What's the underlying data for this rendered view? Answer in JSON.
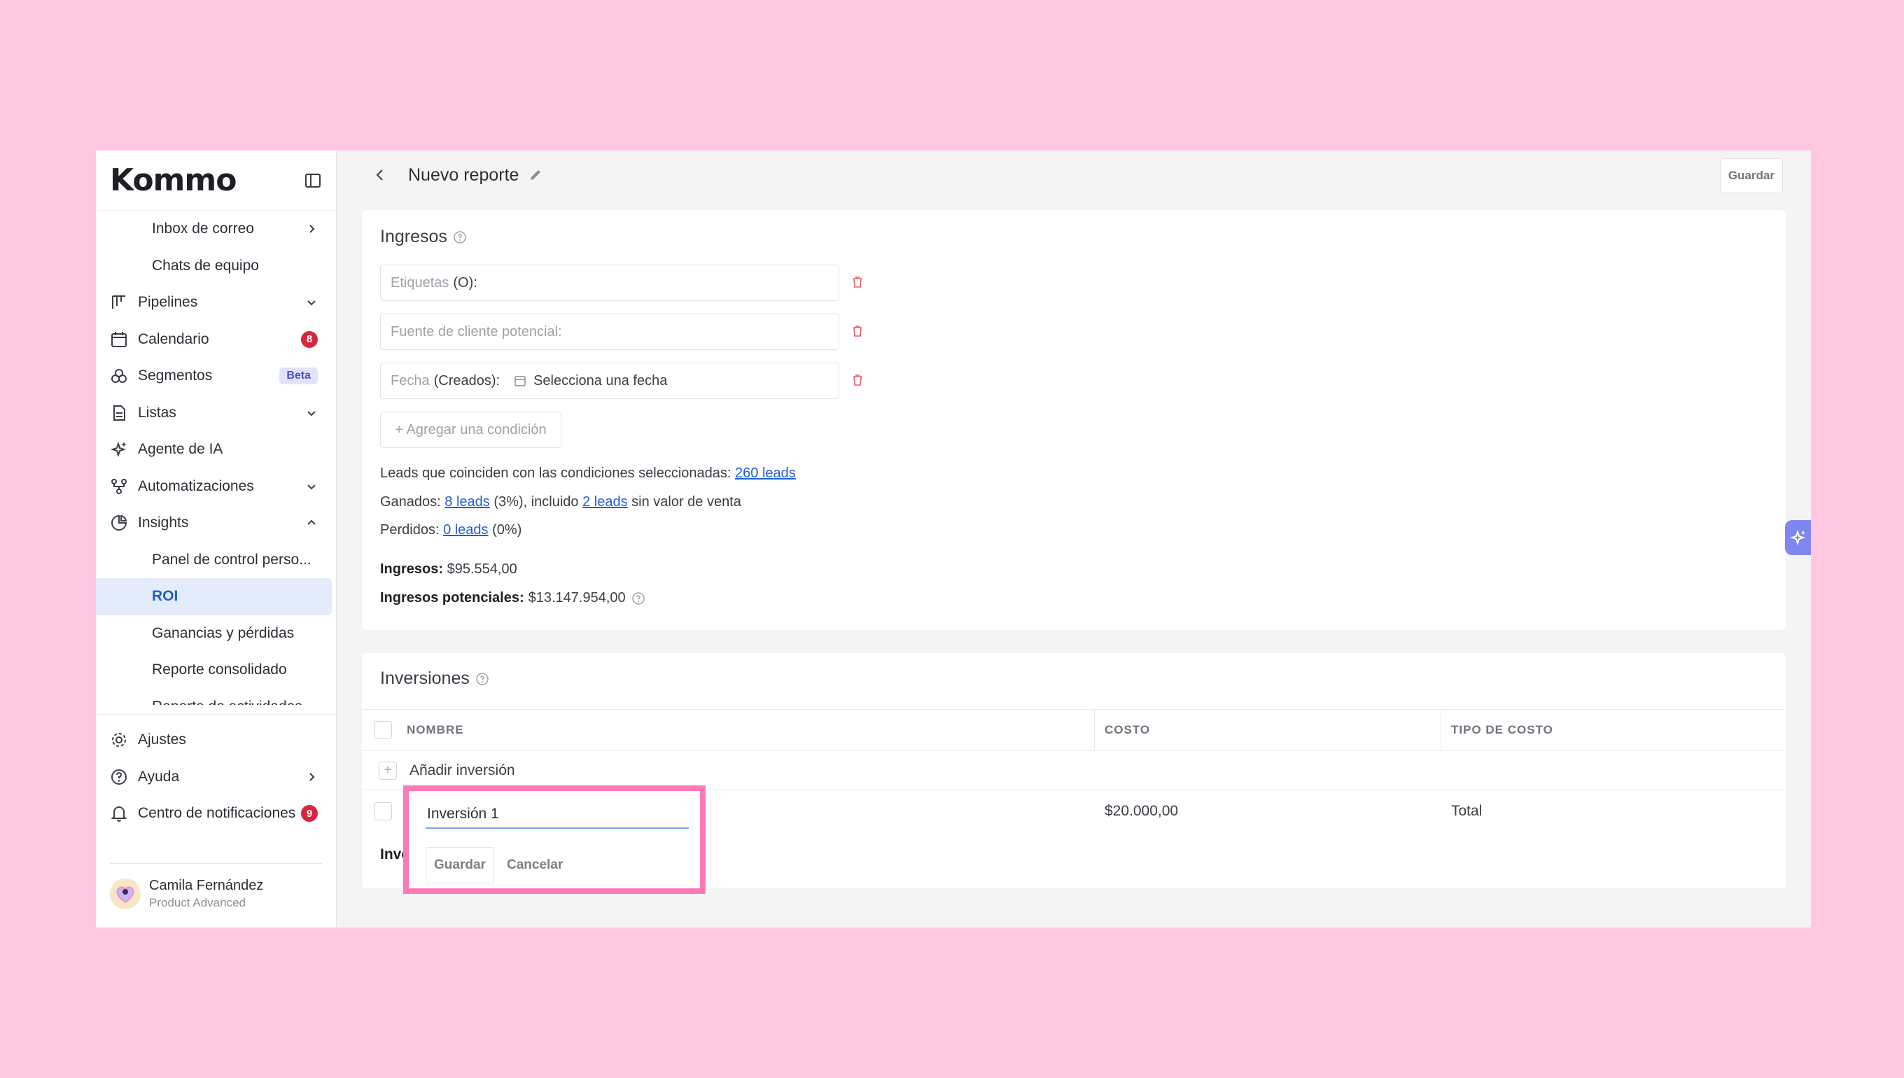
{
  "sidebar": {
    "logo": "Kommo",
    "items": [
      {
        "label": "Inbox de correo",
        "icon": "chevron-right-icon"
      },
      {
        "label": "Chats de equipo"
      },
      {
        "label": "Pipelines",
        "icon": "pipelines-icon"
      },
      {
        "label": "Calendario",
        "icon": "calendar-icon",
        "badge": "8"
      },
      {
        "label": "Segmentos",
        "icon": "segments-icon",
        "badge": "Beta"
      },
      {
        "label": "Listas",
        "icon": "lists-icon"
      },
      {
        "label": "Agente de IA",
        "icon": "sparkle-icon"
      },
      {
        "label": "Automatizaciones",
        "icon": "automation-icon"
      },
      {
        "label": "Insights",
        "icon": "insights-icon"
      },
      {
        "label": "Panel de control perso..."
      },
      {
        "label": "ROI"
      },
      {
        "label": "Ganancias y pérdidas"
      },
      {
        "label": "Reporte consolidado"
      },
      {
        "label": "Reporte de actividades"
      }
    ],
    "bottom": [
      {
        "label": "Ajustes",
        "icon": "gear-icon"
      },
      {
        "label": "Ayuda",
        "icon": "help-circle-icon"
      },
      {
        "label": "Centro de notificaciones",
        "icon": "bell-icon",
        "badge": "9"
      }
    ],
    "user": {
      "name": "Camila Fernández",
      "plan": "Product Advanced"
    }
  },
  "header": {
    "title": "Nuevo reporte",
    "save_label": "Guardar"
  },
  "ingresos": {
    "title": "Ingresos",
    "conditions": [
      {
        "label": "Etiquetas",
        "value": "(O):"
      },
      {
        "label": "Fuente de cliente potencial:",
        "value": ""
      },
      {
        "label": "Fecha",
        "value": "(Creados):",
        "date_placeholder": "Selecciona una fecha"
      }
    ],
    "add_condition": "+ Agregar una condición",
    "matching_text": "Leads que coinciden con las condiciones seleccionadas:",
    "matching_link": "260 leads",
    "won_prefix": "Ganados:",
    "won_link": "8 leads",
    "won_mid": "(3%), incluido",
    "won_link2": "2 leads",
    "won_suffix": "sin valor de venta",
    "lost_prefix": "Perdidos:",
    "lost_link": "0 leads",
    "lost_suffix": "(0%)",
    "revenue_label": "Ingresos:",
    "revenue_value": "$95.554,00",
    "potential_label": "Ingresos potenciales:",
    "potential_value": "$13.147.954,00"
  },
  "inversiones": {
    "title": "Inversiones",
    "columns": [
      "NOMBRE",
      "COSTO",
      "TIPO DE COSTO"
    ],
    "add_label": "Añadir inversión",
    "row": {
      "cost": "$20.000,00",
      "type": "Total"
    },
    "total_label_partial": "Inve"
  },
  "edit_popup": {
    "value": "Inversión 1",
    "save_label": "Guardar",
    "cancel_label": "Cancelar"
  },
  "colors": {
    "background": "#ffc8e0",
    "accent": "#1f5fd1",
    "highlight_border": "#ff79b8",
    "badge_red": "#d7263d"
  }
}
